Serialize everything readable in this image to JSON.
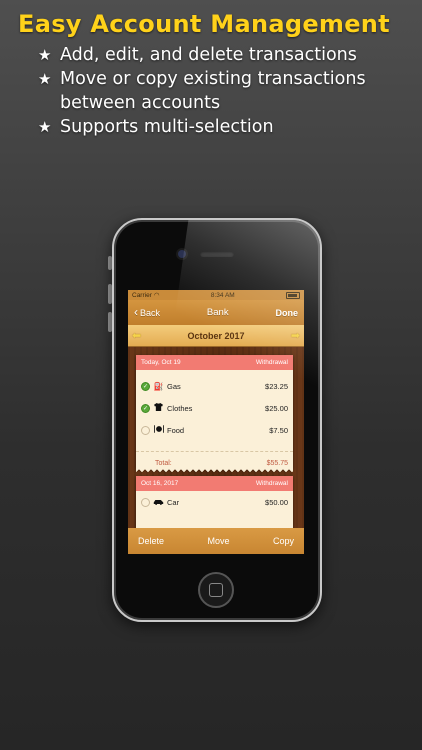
{
  "promo": {
    "headline": "Easy Account Management",
    "bullet_icon": "star-icon",
    "bullets": [
      {
        "lines": [
          "Add, edit, and delete transactions"
        ]
      },
      {
        "lines": [
          "Move or copy existing transactions",
          "between accounts"
        ]
      },
      {
        "lines": [
          "Supports multi-selection"
        ]
      }
    ]
  },
  "status_bar": {
    "carrier": "Carrier",
    "time": "8:34 AM"
  },
  "nav": {
    "back_label": "Back",
    "title": "Bank",
    "done_label": "Done"
  },
  "month_bar": {
    "label": "October 2017"
  },
  "groups": [
    {
      "date": "Today, Oct 19",
      "type": "Withdrawal",
      "items": [
        {
          "name": "Gas",
          "amount": "$23.25",
          "selected": true,
          "icon": "fuel-pump-icon"
        },
        {
          "name": "Clothes",
          "amount": "$25.00",
          "selected": true,
          "icon": "shirt-icon"
        },
        {
          "name": "Food",
          "amount": "$7.50",
          "selected": false,
          "icon": "plate-icon"
        }
      ],
      "total_label": "Total:",
      "total_amount": "$55.75"
    },
    {
      "date": "Oct 16, 2017",
      "type": "Withdrawal",
      "items": [
        {
          "name": "Car",
          "amount": "$50.00",
          "selected": false,
          "icon": "car-icon"
        }
      ]
    }
  ],
  "toolbar": {
    "delete_label": "Delete",
    "move_label": "Move",
    "copy_label": "Copy"
  },
  "colors": {
    "headline": "#ffd21a",
    "nav_bar": "#c98b3a",
    "card_header": "#f27b72",
    "check_on": "#5aa83a"
  }
}
